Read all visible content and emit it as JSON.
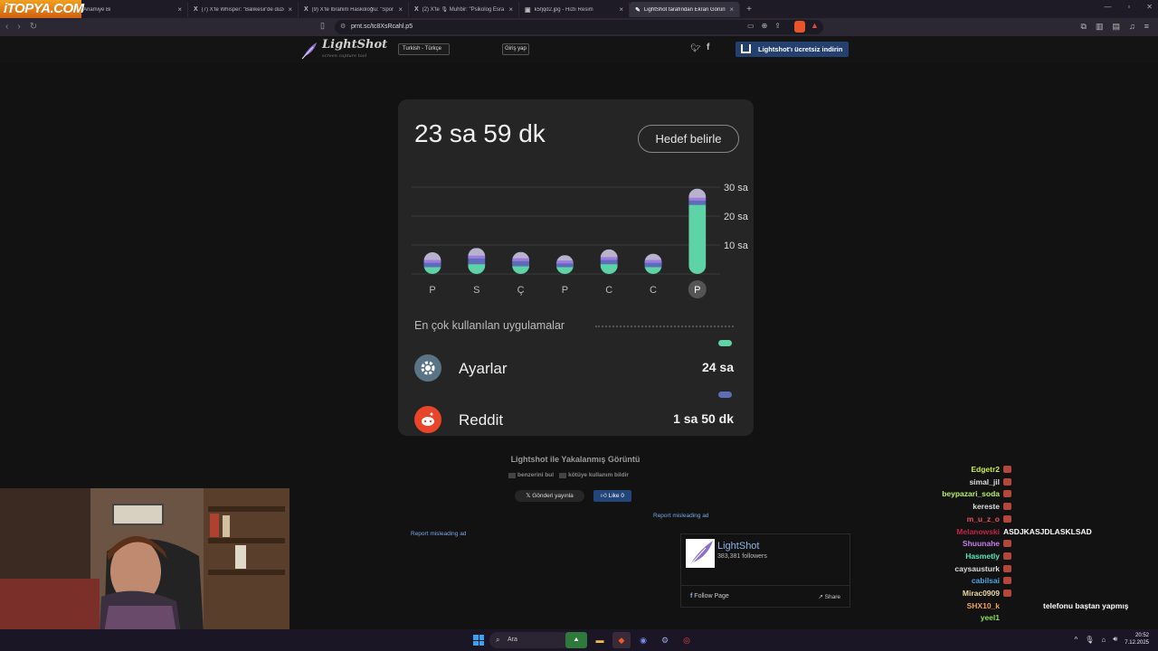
{
  "browser": {
    "site_logo_text": "iTOPYA.COM",
    "tabs": [
      {
        "label": "Anamiye Bi",
        "icon": "",
        "active": false
      },
      {
        "label": "(7) X'te Whisper: \"Balıkesir'de düzen...",
        "icon": "X",
        "active": false
      },
      {
        "label": "(9) X'te İbrahim Haskoloğlu: \"Spor Bak...",
        "icon": "X",
        "active": false
      },
      {
        "label": "(2) X'te 🎙 Muhbir: \"Psikolog Esra E...",
        "icon": "X",
        "active": false
      },
      {
        "label": "k5fjqd2.jpg - Hızlı Resim",
        "icon": "▣",
        "active": false
      },
      {
        "label": "LightShot tarafından Ekran Görüntüsü",
        "icon": "✎",
        "active": true
      }
    ],
    "new_tab": "+",
    "url": "prnt.sc/tc8XsRcahl.p5"
  },
  "lightshot": {
    "brand": "LightShot",
    "tagline": "screen capture tool",
    "language": "Turkish - Türkçe",
    "login": "Giriş yap",
    "download": "Lightshot'ı ücretsiz indirin",
    "caption": "Lightshot ile Yakalanmış Görüntü",
    "find_similar": "benzerini bul",
    "report_abuse": "kötüye kullanım bildir",
    "post_button": "Gönderi yayınla",
    "like_button": "Like 0",
    "report_ad_1": "Report misleading ad",
    "report_ad_2": "Report misleading ad",
    "fb_page": {
      "name": "LightShot",
      "followers": "383,381 followers",
      "follow": "Follow Page",
      "share": "Share"
    }
  },
  "screenshot": {
    "total_time": "23 sa 59 dk",
    "goal_button": "Hedef belirle",
    "most_used_title": "En çok kullanılan uygulamalar",
    "apps": [
      {
        "name": "Ayarlar",
        "time": "24 sa",
        "color": "#5fd3a8",
        "icon": "gear-icon"
      },
      {
        "name": "Reddit",
        "time": "1 sa 50 dk",
        "color": "#5d6db8",
        "icon": "reddit-icon"
      }
    ]
  },
  "chart_data": {
    "type": "bar",
    "categories": [
      "P",
      "S",
      "Ç",
      "P",
      "C",
      "C",
      "P"
    ],
    "series": [
      {
        "values": [
          2.5,
          3.5,
          2.8,
          2.5,
          3.5,
          2.5,
          24
        ]
      },
      {
        "values": [
          1.5,
          2.0,
          1.8,
          1.3,
          1.5,
          1.5,
          1.5
        ]
      },
      {
        "values": [
          1.0,
          1.0,
          1.0,
          1.0,
          1.0,
          1.0,
          1.0
        ]
      },
      {
        "values": [
          2.5,
          2.5,
          2.0,
          1.7,
          2.5,
          2.0,
          3.0
        ]
      }
    ],
    "series_colors": [
      "#5fd3a8",
      "#5d6db8",
      "#9e7be0",
      "#b9b2cc"
    ],
    "yticks": [
      10,
      20,
      30
    ],
    "ytick_labels": [
      "10 sa",
      "20 sa",
      "30 sa"
    ],
    "ylim": [
      0,
      30
    ],
    "highlighted_index": 6
  },
  "chat": [
    {
      "user": "Edgetr2",
      "color": "#c8f04a",
      "msg": ""
    },
    {
      "user": "simal_jil",
      "color": "#dddddd",
      "msg": ""
    },
    {
      "user": "beypazari_soda",
      "color": "#b6f06a",
      "msg": ""
    },
    {
      "user": "kereste",
      "color": "#dddddd",
      "msg": ""
    },
    {
      "user": "m_u_z_o",
      "color": "#e8535b",
      "msg": ""
    },
    {
      "user": "Melanowski",
      "color": "#c0254a",
      "msg": "ASDJKASJDLASKLSAD"
    },
    {
      "user": "Shuunahe",
      "color": "#c77de8",
      "msg": ""
    },
    {
      "user": "Hasmetly",
      "color": "#5ae8b4",
      "msg": ""
    },
    {
      "user": "caysausturk",
      "color": "#dddddd",
      "msg": ""
    },
    {
      "user": "cabilsai",
      "color": "#4aa8e8",
      "msg": ""
    },
    {
      "user": "Mirac0909",
      "color": "#e8d8a8",
      "msg": ""
    },
    {
      "user": "SHX10_k",
      "color": "#f0a060",
      "msg": "telefonu baştan yapmış"
    },
    {
      "user": "yeel1",
      "color": "#8de058",
      "msg": ""
    }
  ],
  "taskbar": {
    "search_placeholder": "Ara",
    "time": "20:52",
    "date": "7.12.2025"
  }
}
